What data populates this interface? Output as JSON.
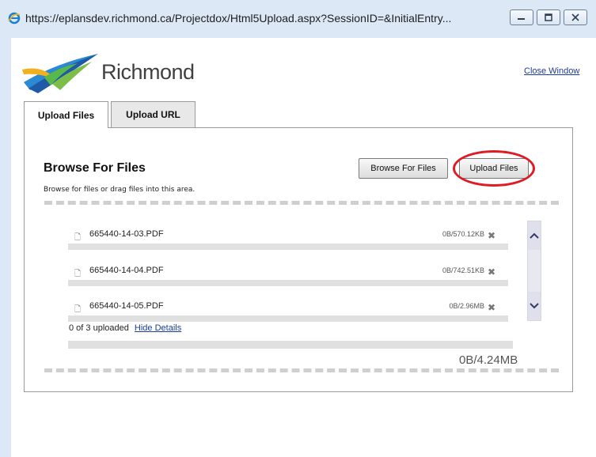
{
  "window": {
    "url": "https://eplansdev.richmond.ca/Projectdox/Html5Upload.aspx?SessionID=&InitialEntry...",
    "chrome_color": "#dce8f5"
  },
  "header": {
    "logo_text": "Richmond",
    "close_window": "Close Window"
  },
  "tabs": [
    {
      "label": "Upload Files",
      "active": true
    },
    {
      "label": "Upload URL",
      "active": false
    }
  ],
  "browse": {
    "title": "Browse For Files",
    "hint": "Browse for files or drag files into this area.",
    "browse_button": "Browse For Files",
    "upload_button": "Upload Files",
    "highlight_color": "#e01b22"
  },
  "files": [
    {
      "name": "665440-14-03.PDF",
      "size": "0B/570.12KB"
    },
    {
      "name": "665440-14-04.PDF",
      "size": "0B/742.51KB"
    },
    {
      "name": "665440-14-05.PDF",
      "size": "0B/2.96MB"
    }
  ],
  "summary": {
    "status": "0 of 3 uploaded",
    "hide_details": "Hide Details",
    "total": "0B/4.24MB"
  }
}
